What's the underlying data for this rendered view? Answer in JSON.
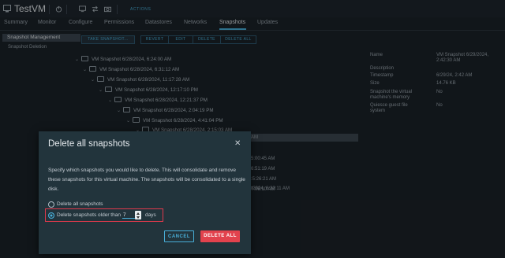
{
  "header": {
    "title": "TestVM",
    "actions_label": "ACTIONS",
    "icons": [
      "vm-icon",
      "power-icon",
      "console-icon",
      "migrate-icon",
      "snapshot-icon"
    ]
  },
  "tabs": [
    {
      "label": "Summary"
    },
    {
      "label": "Monitor"
    },
    {
      "label": "Configure"
    },
    {
      "label": "Permissions"
    },
    {
      "label": "Datastores"
    },
    {
      "label": "Networks"
    },
    {
      "label": "Snapshots",
      "active": true
    },
    {
      "label": "Updates"
    }
  ],
  "left_nav": {
    "items": [
      {
        "label": "Snapshot Management",
        "selected": true
      },
      {
        "label": "Snapshot Deletion"
      }
    ]
  },
  "toolbar": {
    "take": "TAKE SNAPSHOT...",
    "revert": "REVERT",
    "edit": "EDIT",
    "delete": "DELETE",
    "delete_all": "DELETE ALL"
  },
  "tree": [
    {
      "label": "VM Snapshot 6/28/2024, 6:24:00 AM"
    },
    {
      "label": "VM Snapshot 6/28/2024, 6:31:12 AM"
    },
    {
      "label": "VM Snapshot 6/28/2024, 11:17:28 AM"
    },
    {
      "label": "VM Snapshot 6/28/2024, 12:17:10 PM"
    },
    {
      "label": "VM Snapshot 6/28/2024, 12:21:37 PM"
    },
    {
      "label": "VM Snapshot 6/28/2024, 2:04:19 PM"
    },
    {
      "label": "VM Snapshot 6/28/2024, 4:41:04 PM"
    },
    {
      "label": "VM Snapshot 6/28/2024, 2:15:03 AM"
    }
  ],
  "tree_fragments": [
    "AM",
    "5:00:45 AM",
    "6:51:19 AM",
    ":5:26:21 AM",
    "7:06:10 AM",
    "6/29/2024, 8:30:11 AM"
  ],
  "details": [
    {
      "key": "Name",
      "value": "VM Snapshot 6/29/2024, 2:42:30 AM"
    },
    {
      "key": "Description",
      "value": ""
    },
    {
      "key": "Timestamp",
      "value": "6/29/24, 2:42 AM"
    },
    {
      "key": "Size",
      "value": "14.76 KB"
    },
    {
      "key": "Snapshot the virtual machine's memory",
      "value": "No"
    },
    {
      "key": "Quiesce guest file system",
      "value": "No"
    }
  ],
  "dialog": {
    "title": "Delete all snapshots",
    "description": "Specify which snapshots you would like to delete. This will consolidate and remove these snapshots for this virtual machine. The snapshots will be consolidated to a single disk.",
    "option_all": "Delete all snapshots",
    "option_older": "Delete snapshots older than",
    "selected_option": "older",
    "days_value": "7",
    "days_label": "days",
    "cancel": "CANCEL",
    "confirm": "DELETE ALL",
    "colors": {
      "accent": "#49afd9",
      "danger": "#e2424d",
      "highlight": "#e0394c"
    }
  }
}
